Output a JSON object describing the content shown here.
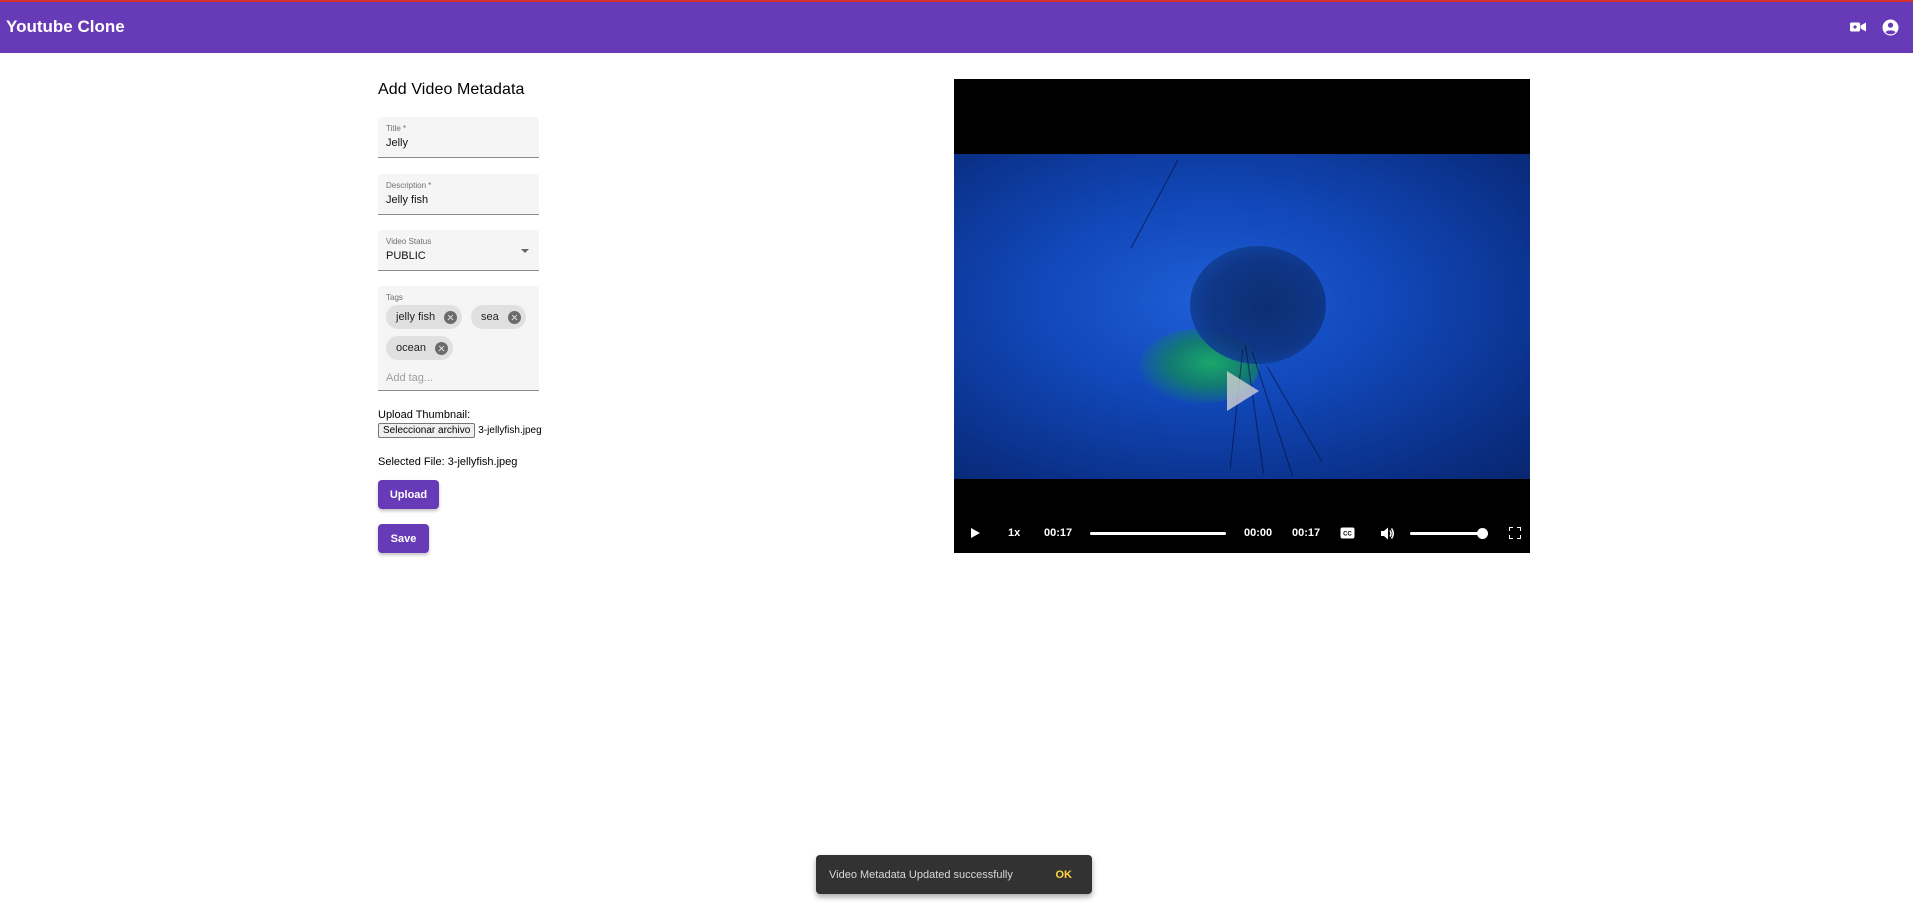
{
  "app": {
    "title": "Youtube Clone",
    "icons": [
      "video-camera-icon",
      "account-circle-icon"
    ],
    "accent": "#673ab7"
  },
  "form": {
    "heading": "Add Video Metadata",
    "title_label": "Title *",
    "title_value": "Jelly",
    "description_label": "Description *",
    "description_value": "Jelly fish",
    "status_label": "Video Status",
    "status_value": "PUBLIC",
    "tags_label": "Tags",
    "tags": [
      "jelly fish",
      "sea",
      "ocean"
    ],
    "tag_placeholder": "Add tag...",
    "upload_thumbnail_label": "Upload Thumbnail:",
    "file_button": "Seleccionar archivo",
    "file_name": "3-jellyfish.jpeg",
    "selected_file": "Selected File: 3-jellyfish.jpeg",
    "upload_button": "Upload",
    "save_button": "Save"
  },
  "player": {
    "speed": "1x",
    "time_left": "00:17",
    "current_time": "00:00",
    "duration": "00:17",
    "progress": 1.0,
    "volume": 1.0
  },
  "snackbar": {
    "message": "Video Metadata Updated successfully",
    "action": "OK"
  }
}
